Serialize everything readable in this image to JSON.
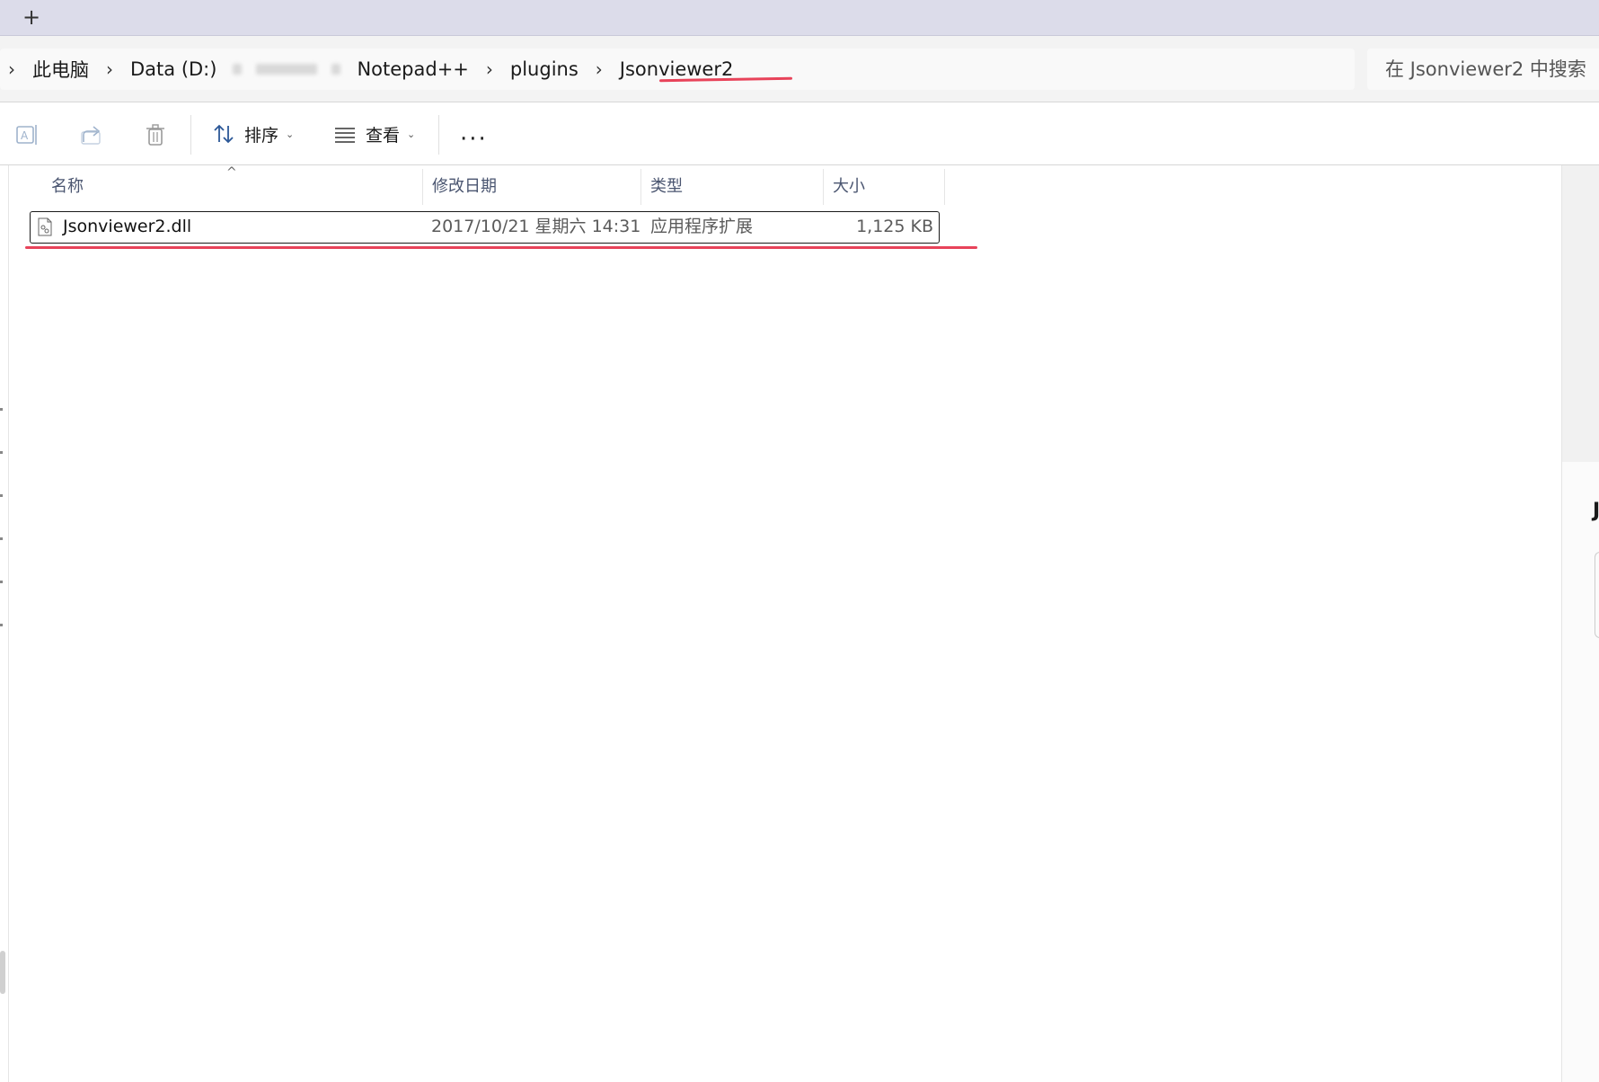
{
  "tabbar": {
    "new_tab_glyph": "+"
  },
  "address": {
    "crumbs": [
      "此电脑",
      "Data (D:)",
      "Notepad++",
      "plugins",
      "Jsonviewer2"
    ],
    "chevron": "›",
    "search_placeholder": "在 Jsonviewer2 中搜索"
  },
  "toolbar": {
    "sort_label": "排序",
    "view_label": "查看",
    "more_label": "···",
    "caret": "⌄"
  },
  "columns": {
    "name": "名称",
    "modified": "修改日期",
    "type": "类型",
    "size": "大小"
  },
  "files": [
    {
      "name": "Jsonviewer2.dll",
      "modified": "2017/10/21 星期六 14:31",
      "type": "应用程序扩展",
      "size": "1,125 KB"
    }
  ],
  "details_panel": {
    "letter": "J"
  },
  "colors": {
    "annotation": "#e8435a",
    "tabbar": "#dcdcea"
  }
}
